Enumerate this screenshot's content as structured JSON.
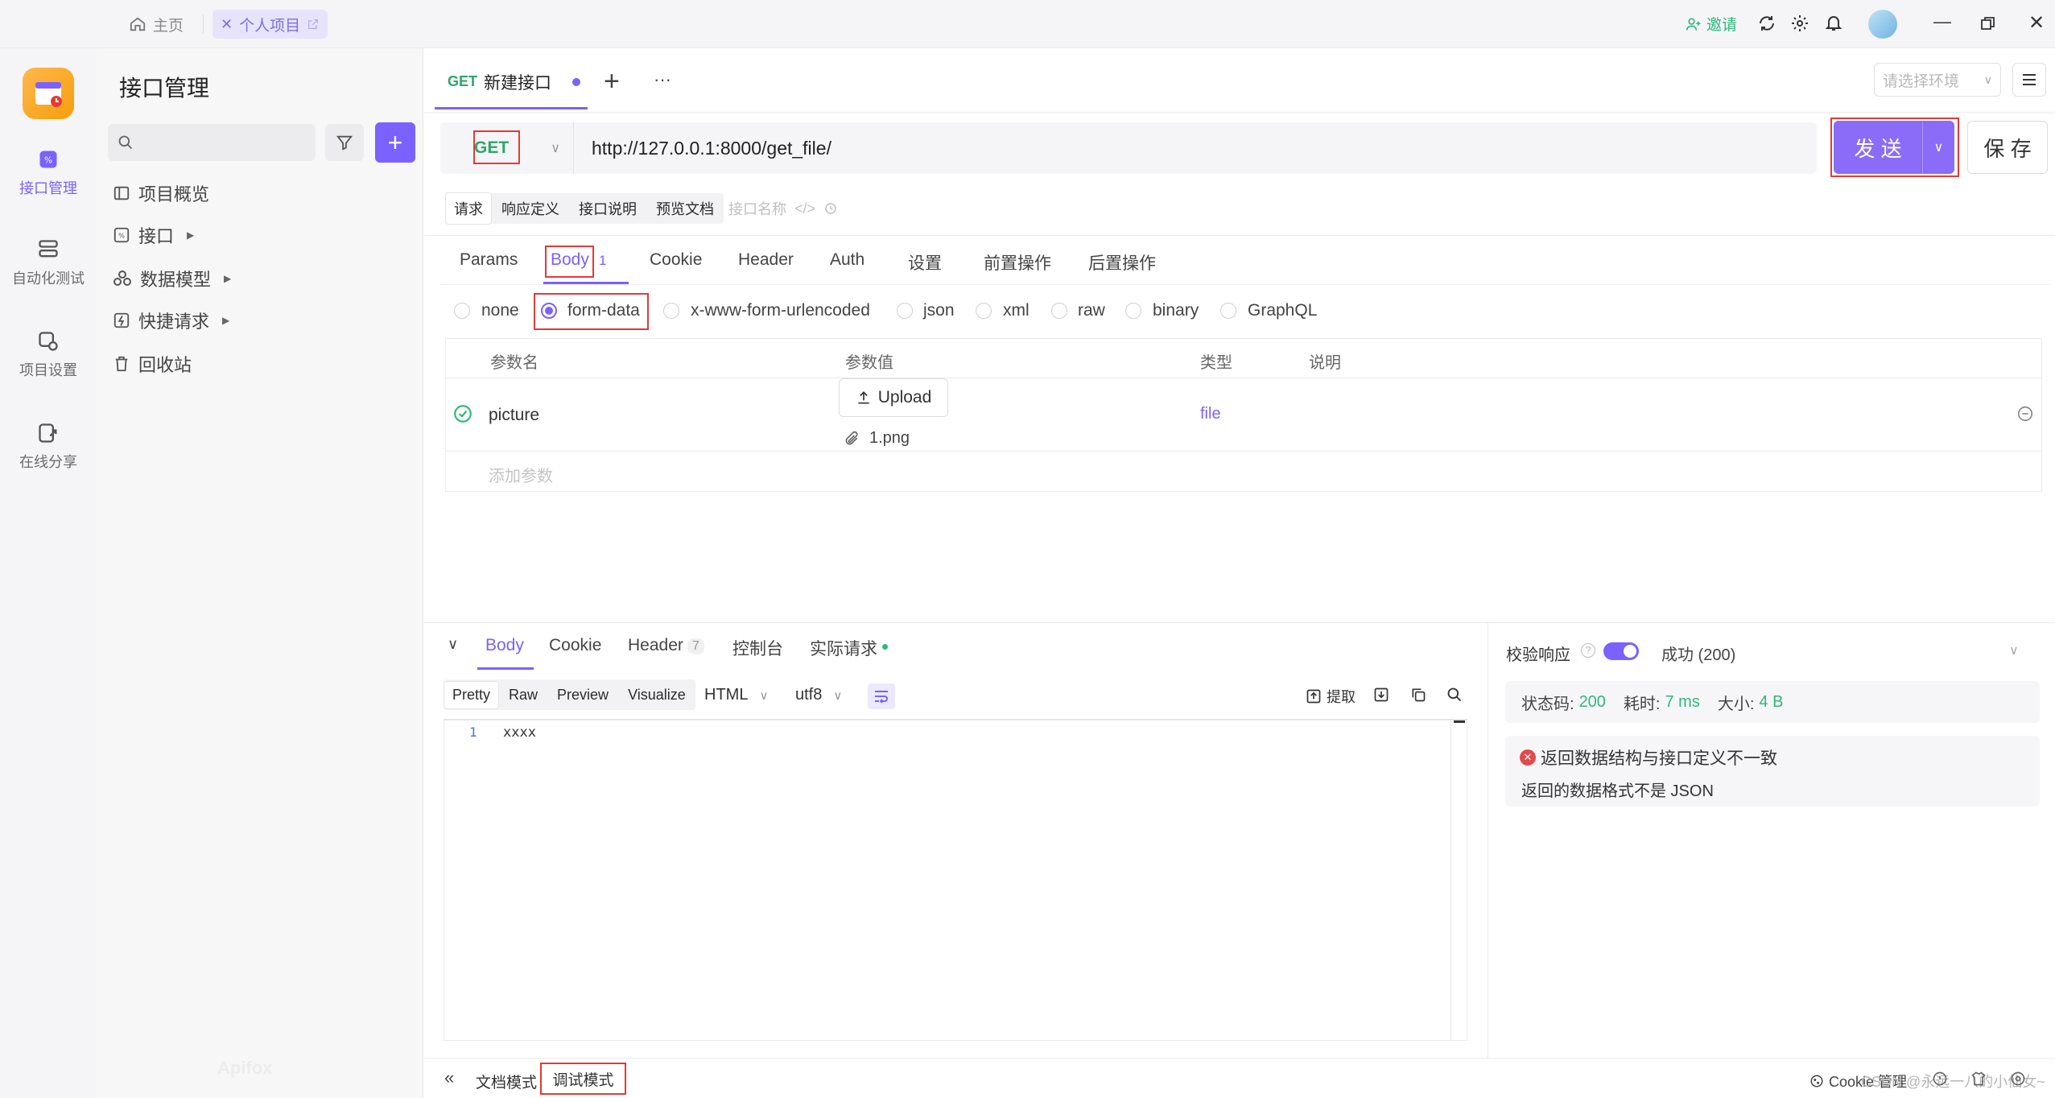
{
  "titlebar": {
    "home_label": "主页",
    "project_tab_label": "个人项目",
    "invite_label": "邀请"
  },
  "rail": {
    "items": [
      {
        "label": "接口管理"
      },
      {
        "label": "自动化测试"
      },
      {
        "label": "项目设置"
      },
      {
        "label": "在线分享"
      }
    ]
  },
  "sidebar": {
    "title": "接口管理",
    "search_placeholder": "",
    "tree": [
      {
        "label": "项目概览"
      },
      {
        "label": "接口"
      },
      {
        "label": "数据模型"
      },
      {
        "label": "快捷请求"
      },
      {
        "label": "回收站"
      }
    ],
    "watermark": "Apifox"
  },
  "editor_tab": {
    "method": "GET",
    "title": "新建接口",
    "add": "+",
    "more": "···"
  },
  "environment": {
    "placeholder": "请选择环境"
  },
  "request": {
    "method": "GET",
    "url": "http://127.0.0.1:8000/get_file/",
    "send_label": "发 送",
    "save_label": "保 存"
  },
  "doc_tabs": {
    "items": [
      "请求",
      "响应定义",
      "接口说明",
      "预览文档"
    ],
    "name_placeholder": "接口名称"
  },
  "param_tabs": {
    "items": [
      "Params",
      "Body",
      "Cookie",
      "Header",
      "Auth",
      "设置",
      "前置操作",
      "后置操作"
    ],
    "body_count": "1"
  },
  "body_types": [
    "none",
    "form-data",
    "x-www-form-urlencoded",
    "json",
    "xml",
    "raw",
    "binary",
    "GraphQL"
  ],
  "params_table": {
    "headers": [
      "参数名",
      "参数值",
      "类型",
      "说明"
    ],
    "rows": [
      {
        "name": "picture",
        "upload_label": "Upload",
        "file": "1.png",
        "type": "file"
      }
    ],
    "add_placeholder": "添加参数"
  },
  "response": {
    "tabs": [
      "Body",
      "Cookie",
      "Header",
      "控制台",
      "实际请求"
    ],
    "header_count": "7",
    "formats": [
      "Pretty",
      "Raw",
      "Preview",
      "Visualize"
    ],
    "lang": "HTML",
    "encoding": "utf8",
    "extract_label": "提取",
    "line_no": "1",
    "body_text": "xxxx"
  },
  "validation": {
    "label": "校验响应",
    "result": "成功 (200)",
    "status_label": "状态码:",
    "status_value": "200",
    "time_label": "耗时:",
    "time_value": "7 ms",
    "size_label": "大小:",
    "size_value": "4 B",
    "error_title": "返回数据结构与接口定义不一致",
    "error_detail": "返回的数据格式不是 JSON"
  },
  "footer": {
    "doc_mode": "文档模式",
    "debug_mode": "调试模式",
    "cookie_manage": "Cookie 管理",
    "watermark": "CSDN @永远一八的小仙女~"
  },
  "colors": {
    "accent": "#7b61ff",
    "get_method": "#2fa66a",
    "highlight_box": "#e53935",
    "success": "#2fb87a",
    "error": "#e5484d"
  }
}
